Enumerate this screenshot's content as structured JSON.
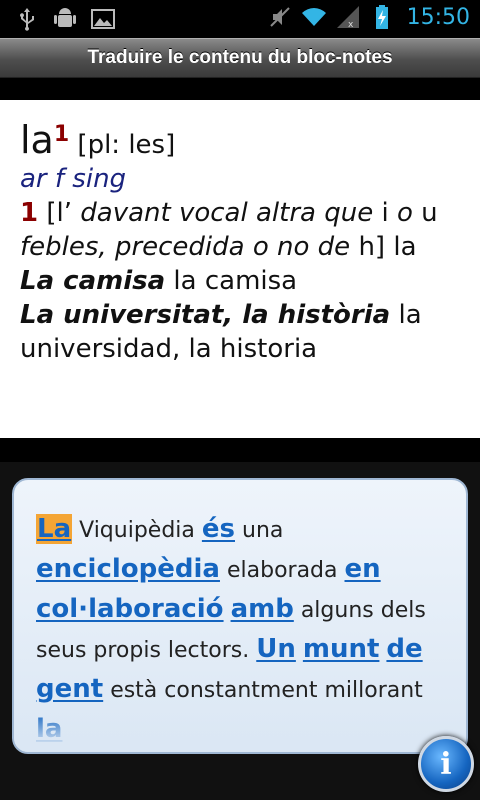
{
  "status": {
    "clock": "15:50",
    "icons": [
      "usb-icon",
      "android-debug-icon",
      "gallery-icon",
      "mute-icon",
      "wifi-icon",
      "signal-icon",
      "battery-charging-icon"
    ]
  },
  "title": "Traduire le contenu du bloc-notes",
  "dictionary": {
    "headword": "la",
    "superscript": "1",
    "plural": "[pl: les]",
    "grammar": "ar f sing",
    "sense_number": "1",
    "note_open": "[l’",
    "note_italic_1": "davant vocal altra que",
    "note_i": "i",
    "note_o": "o",
    "note_u": "u",
    "note_italic_2": "febles, precedida o no de",
    "note_h": "h] la",
    "ex1_src": "La camisa",
    "ex1_tr": "la camisa",
    "ex2_src": "La universitat, la història",
    "ex2_tr": "la universidad, la historia"
  },
  "notepad": {
    "t1": "La",
    "t2": "Viquipèdia",
    "t3": "és",
    "t4": "una",
    "t5": "enciclopèdia",
    "t6": "elaborada",
    "t7": "en",
    "t8": "col·laboració",
    "t9": "amb",
    "t10": "alguns",
    "t11": "dels seus propis lectors.",
    "t12": "Un",
    "t13": "munt",
    "t14": "de",
    "t15": "gent",
    "t16": "està",
    "t17": "constantment millorant",
    "t18": "la"
  },
  "colors": {
    "accent": "#33b5e5",
    "link": "#1565c0",
    "highlight": "#f4a535",
    "grammar": "#1a237e",
    "sense": "#8b0000"
  }
}
